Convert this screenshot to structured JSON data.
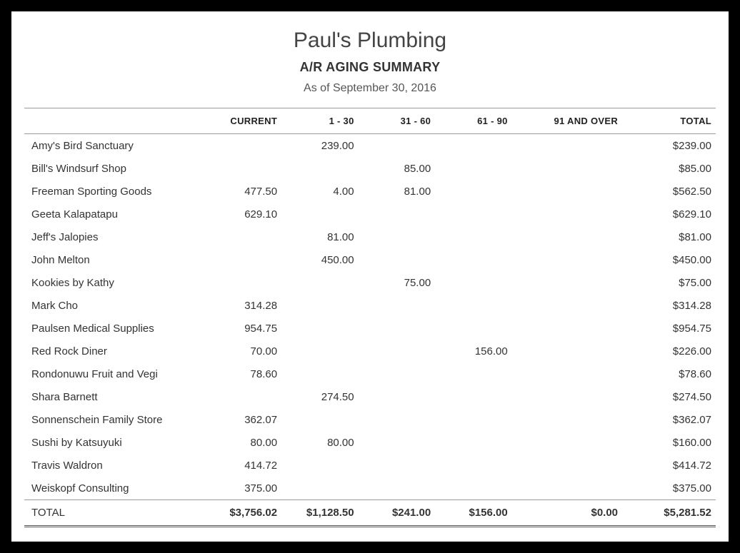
{
  "header": {
    "company": "Paul's Plumbing",
    "title": "A/R AGING SUMMARY",
    "as_of": "As of September 30, 2016"
  },
  "columns": {
    "name": "",
    "current": "CURRENT",
    "d1_30": "1 - 30",
    "d31_60": "31 - 60",
    "d61_90": "61 - 90",
    "d91_over": "91 AND OVER",
    "total": "TOTAL"
  },
  "rows": [
    {
      "name": "Amy's Bird Sanctuary",
      "current": "",
      "d1_30": "239.00",
      "d31_60": "",
      "d61_90": "",
      "d91_over": "",
      "total": "$239.00"
    },
    {
      "name": "Bill's Windsurf Shop",
      "current": "",
      "d1_30": "",
      "d31_60": "85.00",
      "d61_90": "",
      "d91_over": "",
      "total": "$85.00"
    },
    {
      "name": "Freeman Sporting Goods",
      "current": "477.50",
      "d1_30": "4.00",
      "d31_60": "81.00",
      "d61_90": "",
      "d91_over": "",
      "total": "$562.50"
    },
    {
      "name": "Geeta Kalapatapu",
      "current": "629.10",
      "d1_30": "",
      "d31_60": "",
      "d61_90": "",
      "d91_over": "",
      "total": "$629.10"
    },
    {
      "name": "Jeff's Jalopies",
      "current": "",
      "d1_30": "81.00",
      "d31_60": "",
      "d61_90": "",
      "d91_over": "",
      "total": "$81.00"
    },
    {
      "name": "John Melton",
      "current": "",
      "d1_30": "450.00",
      "d31_60": "",
      "d61_90": "",
      "d91_over": "",
      "total": "$450.00"
    },
    {
      "name": "Kookies by Kathy",
      "current": "",
      "d1_30": "",
      "d31_60": "75.00",
      "d61_90": "",
      "d91_over": "",
      "total": "$75.00"
    },
    {
      "name": "Mark Cho",
      "current": "314.28",
      "d1_30": "",
      "d31_60": "",
      "d61_90": "",
      "d91_over": "",
      "total": "$314.28"
    },
    {
      "name": "Paulsen Medical Supplies",
      "current": "954.75",
      "d1_30": "",
      "d31_60": "",
      "d61_90": "",
      "d91_over": "",
      "total": "$954.75"
    },
    {
      "name": "Red Rock Diner",
      "current": "70.00",
      "d1_30": "",
      "d31_60": "",
      "d61_90": "156.00",
      "d91_over": "",
      "total": "$226.00"
    },
    {
      "name": "Rondonuwu Fruit and Vegi",
      "current": "78.60",
      "d1_30": "",
      "d31_60": "",
      "d61_90": "",
      "d91_over": "",
      "total": "$78.60"
    },
    {
      "name": "Shara Barnett",
      "current": "",
      "d1_30": "274.50",
      "d31_60": "",
      "d61_90": "",
      "d91_over": "",
      "total": "$274.50"
    },
    {
      "name": "Sonnenschein Family Store",
      "current": "362.07",
      "d1_30": "",
      "d31_60": "",
      "d61_90": "",
      "d91_over": "",
      "total": "$362.07"
    },
    {
      "name": "Sushi by Katsuyuki",
      "current": "80.00",
      "d1_30": "80.00",
      "d31_60": "",
      "d61_90": "",
      "d91_over": "",
      "total": "$160.00"
    },
    {
      "name": "Travis Waldron",
      "current": "414.72",
      "d1_30": "",
      "d31_60": "",
      "d61_90": "",
      "d91_over": "",
      "total": "$414.72"
    },
    {
      "name": "Weiskopf Consulting",
      "current": "375.00",
      "d1_30": "",
      "d31_60": "",
      "d61_90": "",
      "d91_over": "",
      "total": "$375.00"
    }
  ],
  "totals": {
    "label": "TOTAL",
    "current": "$3,756.02",
    "d1_30": "$1,128.50",
    "d31_60": "$241.00",
    "d61_90": "$156.00",
    "d91_over": "$0.00",
    "total": "$5,281.52"
  }
}
